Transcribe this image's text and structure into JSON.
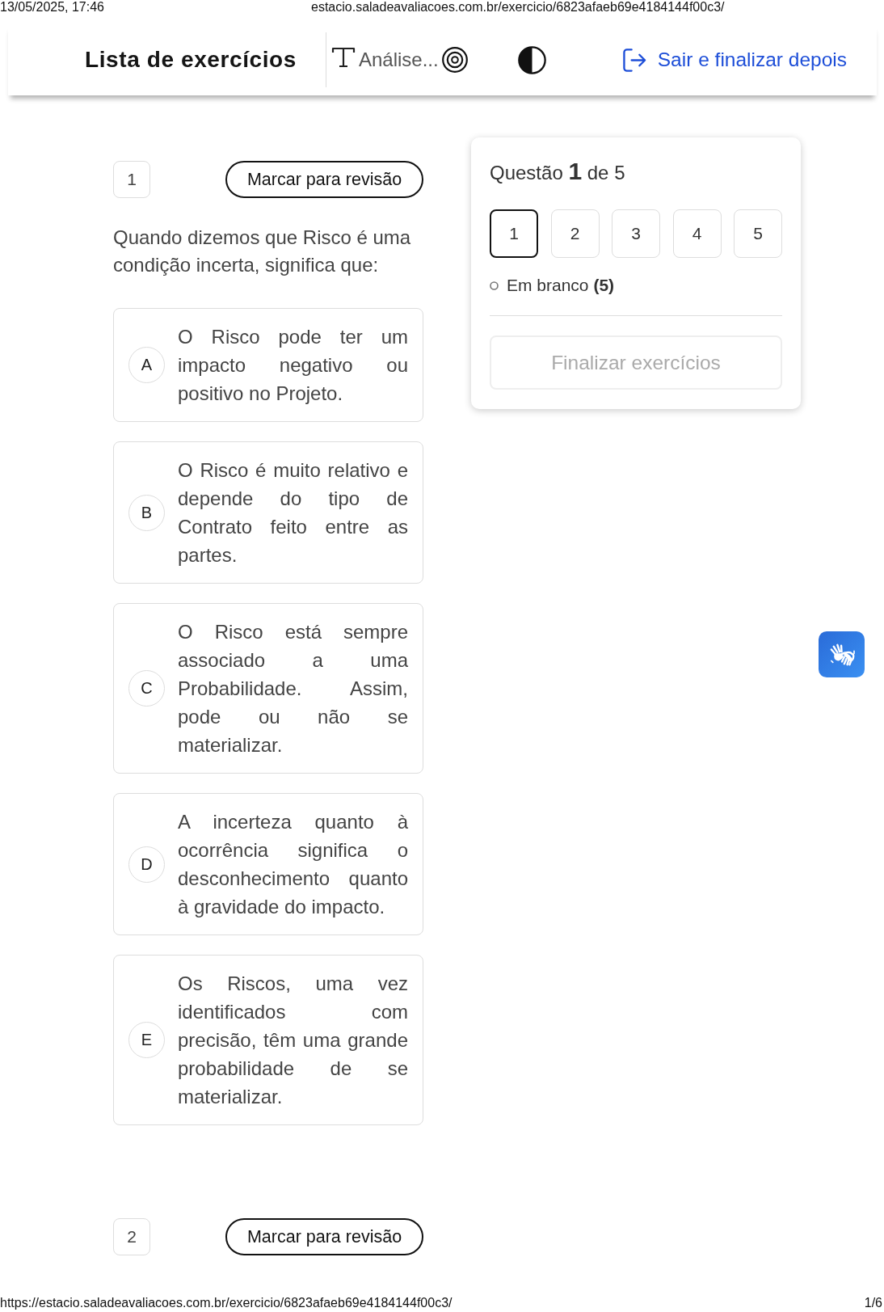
{
  "print_header": {
    "datetime": "13/05/2025, 17:46",
    "url": "estacio.saladeavaliacoes.com.br/exercicio/6823afaeb69e4184144f00c3/"
  },
  "header": {
    "title": "Lista de exercícios",
    "section": "Análise...",
    "exit_link": "Sair e finalizar depois"
  },
  "questions": [
    {
      "number": "1",
      "review_button": "Marcar para revisão",
      "statement": "Quando dizemos que Risco é uma condição incerta, significa que:",
      "options": [
        {
          "letter": "A",
          "text": "O Risco pode ter um impacto negativo ou positivo no Projeto.",
          "selected": false
        },
        {
          "letter": "B",
          "text": "O Risco é muito relativo e depende do tipo de Contrato feito entre as partes.",
          "selected": false
        },
        {
          "letter": "C",
          "text": "O Risco está sempre associado a uma Probabilidade. Assim, pode ou não se materializar.",
          "selected": false
        },
        {
          "letter": "D",
          "text": "A incerteza quanto à ocorrência significa o desconhecimento quanto à gravidade do impacto.",
          "selected": false
        },
        {
          "letter": "E",
          "text": "Os Riscos, uma vez identificados com precisão, têm uma grande probabilidade de se materializar.",
          "selected": false
        }
      ]
    },
    {
      "number": "2",
      "review_button": "Marcar para revisão"
    }
  ],
  "navigator": {
    "title": "Questão **1** de 5",
    "questions": [
      {
        "label": "1",
        "selected": true
      },
      {
        "label": "2",
        "selected": false
      },
      {
        "label": "3",
        "selected": false
      },
      {
        "label": "4",
        "selected": false
      },
      {
        "label": "5",
        "selected": false
      }
    ],
    "blank_status": "Em branco **(5)**",
    "finish_button": {
      "label": "Finalizar exercícios",
      "disabled": true
    }
  },
  "print_footer": {
    "url": "https://estacio.saladeavaliacoes.com.br/exercicio/6823afaeb69e4184144f00c3/",
    "page": "1/6"
  }
}
